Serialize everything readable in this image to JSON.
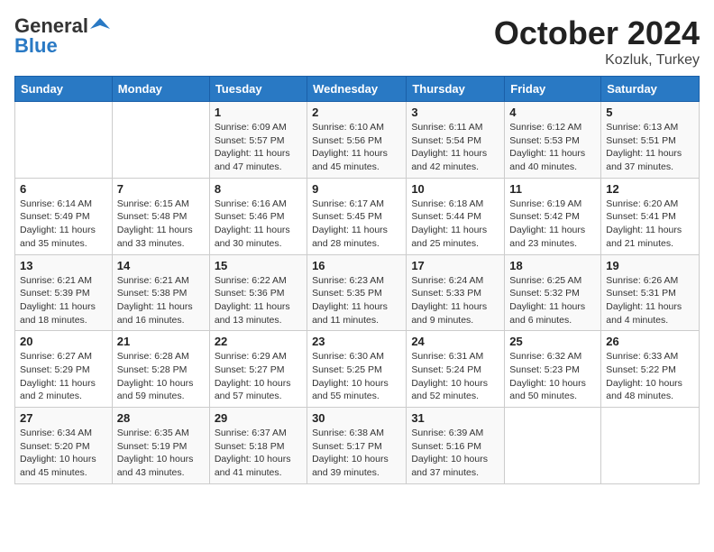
{
  "header": {
    "logo_general": "General",
    "logo_blue": "Blue",
    "month": "October 2024",
    "location": "Kozluk, Turkey"
  },
  "days_of_week": [
    "Sunday",
    "Monday",
    "Tuesday",
    "Wednesday",
    "Thursday",
    "Friday",
    "Saturday"
  ],
  "weeks": [
    [
      {
        "num": "",
        "info": ""
      },
      {
        "num": "",
        "info": ""
      },
      {
        "num": "1",
        "info": "Sunrise: 6:09 AM\nSunset: 5:57 PM\nDaylight: 11 hours and 47 minutes."
      },
      {
        "num": "2",
        "info": "Sunrise: 6:10 AM\nSunset: 5:56 PM\nDaylight: 11 hours and 45 minutes."
      },
      {
        "num": "3",
        "info": "Sunrise: 6:11 AM\nSunset: 5:54 PM\nDaylight: 11 hours and 42 minutes."
      },
      {
        "num": "4",
        "info": "Sunrise: 6:12 AM\nSunset: 5:53 PM\nDaylight: 11 hours and 40 minutes."
      },
      {
        "num": "5",
        "info": "Sunrise: 6:13 AM\nSunset: 5:51 PM\nDaylight: 11 hours and 37 minutes."
      }
    ],
    [
      {
        "num": "6",
        "info": "Sunrise: 6:14 AM\nSunset: 5:49 PM\nDaylight: 11 hours and 35 minutes."
      },
      {
        "num": "7",
        "info": "Sunrise: 6:15 AM\nSunset: 5:48 PM\nDaylight: 11 hours and 33 minutes."
      },
      {
        "num": "8",
        "info": "Sunrise: 6:16 AM\nSunset: 5:46 PM\nDaylight: 11 hours and 30 minutes."
      },
      {
        "num": "9",
        "info": "Sunrise: 6:17 AM\nSunset: 5:45 PM\nDaylight: 11 hours and 28 minutes."
      },
      {
        "num": "10",
        "info": "Sunrise: 6:18 AM\nSunset: 5:44 PM\nDaylight: 11 hours and 25 minutes."
      },
      {
        "num": "11",
        "info": "Sunrise: 6:19 AM\nSunset: 5:42 PM\nDaylight: 11 hours and 23 minutes."
      },
      {
        "num": "12",
        "info": "Sunrise: 6:20 AM\nSunset: 5:41 PM\nDaylight: 11 hours and 21 minutes."
      }
    ],
    [
      {
        "num": "13",
        "info": "Sunrise: 6:21 AM\nSunset: 5:39 PM\nDaylight: 11 hours and 18 minutes."
      },
      {
        "num": "14",
        "info": "Sunrise: 6:21 AM\nSunset: 5:38 PM\nDaylight: 11 hours and 16 minutes."
      },
      {
        "num": "15",
        "info": "Sunrise: 6:22 AM\nSunset: 5:36 PM\nDaylight: 11 hours and 13 minutes."
      },
      {
        "num": "16",
        "info": "Sunrise: 6:23 AM\nSunset: 5:35 PM\nDaylight: 11 hours and 11 minutes."
      },
      {
        "num": "17",
        "info": "Sunrise: 6:24 AM\nSunset: 5:33 PM\nDaylight: 11 hours and 9 minutes."
      },
      {
        "num": "18",
        "info": "Sunrise: 6:25 AM\nSunset: 5:32 PM\nDaylight: 11 hours and 6 minutes."
      },
      {
        "num": "19",
        "info": "Sunrise: 6:26 AM\nSunset: 5:31 PM\nDaylight: 11 hours and 4 minutes."
      }
    ],
    [
      {
        "num": "20",
        "info": "Sunrise: 6:27 AM\nSunset: 5:29 PM\nDaylight: 11 hours and 2 minutes."
      },
      {
        "num": "21",
        "info": "Sunrise: 6:28 AM\nSunset: 5:28 PM\nDaylight: 10 hours and 59 minutes."
      },
      {
        "num": "22",
        "info": "Sunrise: 6:29 AM\nSunset: 5:27 PM\nDaylight: 10 hours and 57 minutes."
      },
      {
        "num": "23",
        "info": "Sunrise: 6:30 AM\nSunset: 5:25 PM\nDaylight: 10 hours and 55 minutes."
      },
      {
        "num": "24",
        "info": "Sunrise: 6:31 AM\nSunset: 5:24 PM\nDaylight: 10 hours and 52 minutes."
      },
      {
        "num": "25",
        "info": "Sunrise: 6:32 AM\nSunset: 5:23 PM\nDaylight: 10 hours and 50 minutes."
      },
      {
        "num": "26",
        "info": "Sunrise: 6:33 AM\nSunset: 5:22 PM\nDaylight: 10 hours and 48 minutes."
      }
    ],
    [
      {
        "num": "27",
        "info": "Sunrise: 6:34 AM\nSunset: 5:20 PM\nDaylight: 10 hours and 45 minutes."
      },
      {
        "num": "28",
        "info": "Sunrise: 6:35 AM\nSunset: 5:19 PM\nDaylight: 10 hours and 43 minutes."
      },
      {
        "num": "29",
        "info": "Sunrise: 6:37 AM\nSunset: 5:18 PM\nDaylight: 10 hours and 41 minutes."
      },
      {
        "num": "30",
        "info": "Sunrise: 6:38 AM\nSunset: 5:17 PM\nDaylight: 10 hours and 39 minutes."
      },
      {
        "num": "31",
        "info": "Sunrise: 6:39 AM\nSunset: 5:16 PM\nDaylight: 10 hours and 37 minutes."
      },
      {
        "num": "",
        "info": ""
      },
      {
        "num": "",
        "info": ""
      }
    ]
  ]
}
